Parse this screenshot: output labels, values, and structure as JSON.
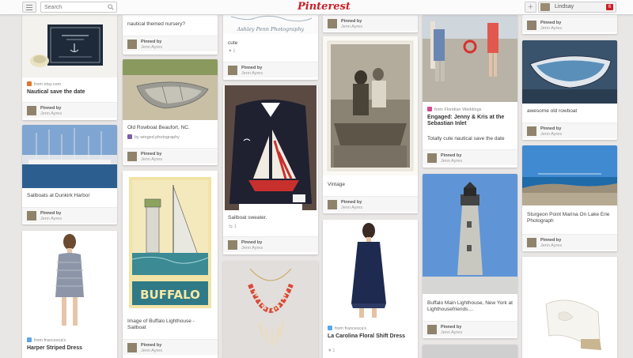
{
  "header": {
    "search_placeholder": "Search",
    "logo": "Pinterest",
    "user_name": "Lindsay",
    "notifications": "6",
    "add_label": "+"
  },
  "pins": {
    "nautical_std": {
      "source": "from etsy.com",
      "title": "Nautical save the date",
      "pinned": "Pinned by",
      "by": "Jenn Ayres"
    },
    "sailboats_dunkirk": {
      "title": "Sailboats at Dunkirk Harbor",
      "pinned": "Pinned by",
      "by": "Jenn Ayres"
    },
    "harper_dress": {
      "source": "from francesca's",
      "title": "Harper Striped Dress"
    },
    "nursery": {
      "desc": "nautical themed nursery?",
      "pinned": "Pinned by",
      "by": "Jenn Ayres"
    },
    "rowboat_beaufort": {
      "desc": "Old Rowboat Beaufort, NC.",
      "source": "by winged photography",
      "pinned": "Pinned by",
      "by": "Jenn Ayres"
    },
    "buffalo_poster": {
      "poster_text": "BUFFALO",
      "desc": "Image of Buffalo Lighthouse - Sailboat",
      "pinned": "Pinned by",
      "by": "Jenn Ayres"
    },
    "cute": {
      "photo_credit": "Ashley Penn Photography",
      "desc": "cute",
      "likes": "1",
      "pinned": "Pinned by",
      "by": "Jenn Ayres"
    },
    "sweater": {
      "desc": "Sailboat sweater.",
      "repins": "1",
      "pinned": "Pinned by",
      "by": "Jenn Ayres"
    },
    "top_col4": {
      "pinned": "Pinned by",
      "by": "Jenn Ayres"
    },
    "vintage": {
      "desc": "Vintage",
      "pinned": "Pinned by",
      "by": "Jenn Ayres"
    },
    "la_carolina": {
      "source": "from francesca's",
      "title": "La Carolina Floral Shift Dress",
      "likes": "1"
    },
    "engaged": {
      "source": "from Floridian Weddings",
      "title": "Engaged: Jenny & Kris at the Sebastian Inlet",
      "desc": "Totally cute nautical save the date",
      "pinned": "Pinned by",
      "by": "Jenn Ayres"
    },
    "buffalo_main": {
      "desc": "Buffalo Main Lighthouse, New York at Lighthousefriends....",
      "pinned": "Pinned by",
      "by": "Jenn Ayres"
    },
    "top_col6": {
      "pinned": "Pinned by",
      "by": "Jenn Ayres"
    },
    "awesome_rowboat": {
      "desc": "awesome old rowboat",
      "pinned": "Pinned by",
      "by": "Jenn Ayres"
    },
    "sturgeon": {
      "desc": "Sturgeon Point Marina On Lake Erie Photograph",
      "pinned": "Pinned by",
      "by": "Jenn Ayres"
    }
  },
  "colors": {
    "brand": "#cb2027",
    "background": "#e9e6e6"
  }
}
